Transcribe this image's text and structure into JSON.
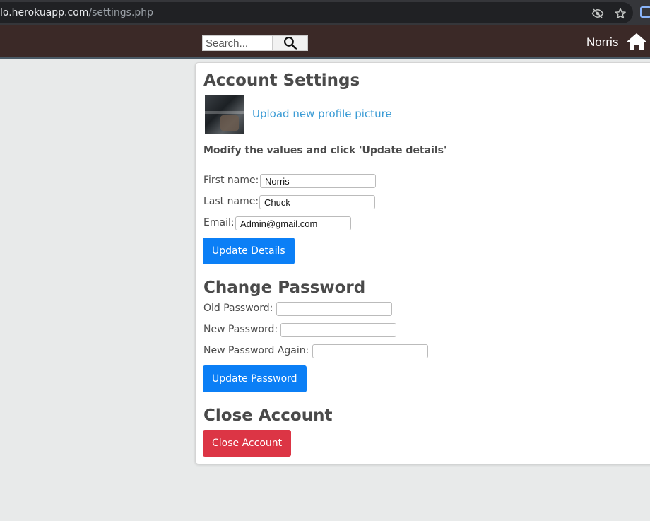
{
  "browser": {
    "url_host": "lo.herokuapp.com",
    "url_path": "/settings.php"
  },
  "navbar": {
    "search_placeholder": "Search...",
    "username": "Norris"
  },
  "account_settings": {
    "title": "Account Settings",
    "upload_link": "Upload new profile picture",
    "instructions": "Modify the values and click 'Update details'",
    "first_name_label": "First name:",
    "first_name_value": "Norris",
    "last_name_label": "Last name:",
    "last_name_value": "Chuck",
    "email_label": "Email:",
    "email_value": "Admin@gmail.com",
    "update_button": "Update Details"
  },
  "change_password": {
    "title": "Change Password",
    "old_label": "Old Password:",
    "new_label": "New Password:",
    "again_label": "New Password Again:",
    "update_button": "Update Password"
  },
  "close_account": {
    "title": "Close Account",
    "button": "Close Account"
  },
  "colors": {
    "navbar": "#3b2927",
    "primary_button": "#0b7ff6",
    "danger_button": "#dc3545",
    "link": "#3a9bd5"
  }
}
